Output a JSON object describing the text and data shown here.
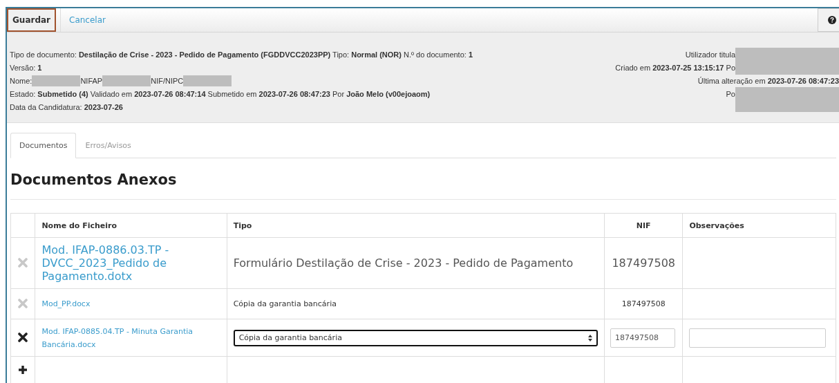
{
  "toolbar": {
    "buttons": [
      {
        "label": "Guardar",
        "kind": "primary",
        "focused": true
      },
      {
        "label": "Cancelar",
        "kind": "link"
      }
    ]
  },
  "info": {
    "left": [
      [
        {
          "kind": "text",
          "t": "Tipo de documento: **Destilação de Crise - 2023 - Pedido de Pagamento (FGDDVCC2023PP)** Tipo: **Normal (NOR)** N.º do documento: **1**"
        }
      ],
      [
        {
          "kind": "text",
          "t": "Versão: **1**"
        }
      ],
      [
        {
          "kind": "text",
          "t": "Nome: "
        },
        {
          "kind": "redacted"
        },
        {
          "kind": "text",
          "t": " NIFAP"
        },
        {
          "kind": "redacted"
        },
        {
          "kind": "text",
          "t": " NIF/NIPC"
        },
        {
          "kind": "redacted"
        }
      ],
      [
        {
          "kind": "text",
          "t": "Estado: **Submetido (4)** Validado em **2023-07-26 08:47:14** Submetido em **2023-07-26 08:47:23** Por **João Melo (v00ejoaom)**"
        }
      ],
      [
        {
          "kind": "text",
          "t": "Data da Candidatura: **2023-07-26**"
        }
      ]
    ],
    "right": [
      [
        {
          "kind": "text",
          "t": "Utilizador titula"
        },
        {
          "kind": "redacted"
        }
      ],
      [
        {
          "kind": "text",
          "t": "Criado em **2023-07-25 13:15:17** Po"
        },
        {
          "kind": "redacted"
        }
      ],
      [
        {
          "kind": "text",
          "t": "Última alteração em **2023-07-26 08:47:23**"
        }
      ],
      [
        {
          "kind": "text",
          "t": "Po"
        },
        {
          "kind": "redacted"
        }
      ]
    ]
  },
  "tabs": [
    {
      "label": "Documentos",
      "selected": true
    },
    {
      "label": "Erros/Avisos",
      "selected": false
    }
  ],
  "heading": "Documentos Anexos",
  "table": {
    "columns": [
      "Nome do Ficheiro",
      "Tipo",
      "NIF",
      "Observações"
    ],
    "rows": [
      {
        "kind": "large",
        "removable": false,
        "file": "Mod. IFAP-0886.03.TP - DVCC_2023_Pedido de Pagamento.dotx",
        "type": "Formulário Destilação de Crise - 2023 - Pedido de Pagamento",
        "nif": "187497508"
      },
      {
        "kind": "plain",
        "removable": false,
        "file": "Mod_PP.docx",
        "type": "Cópia da garantia bancária",
        "nif": "187497508"
      },
      {
        "kind": "editable",
        "removable": true,
        "file": "Mod. IFAP-0885.04.TP - Minuta Garantia Bancária.docx",
        "type": "Cópia da garantia bancária",
        "type_focused": true,
        "nif": "187497508"
      }
    ]
  }
}
